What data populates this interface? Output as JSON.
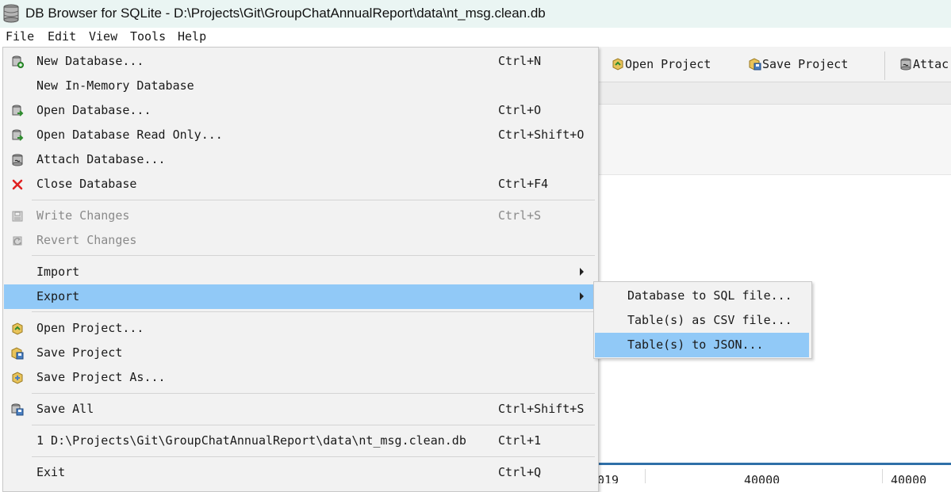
{
  "window": {
    "title": "DB Browser for SQLite - D:\\Projects\\Git\\GroupChatAnnualReport\\data\\nt_msg.clean.db",
    "icon": "database-icon"
  },
  "menubar": [
    "File",
    "Edit",
    "View",
    "Tools",
    "Help"
  ],
  "toolbar": {
    "open_project": "Open Project",
    "save_project": "Save Project",
    "attach": "Attac"
  },
  "file_menu": [
    {
      "label": "New Database...",
      "shortcut": "Ctrl+N",
      "icon": "new-database-icon"
    },
    {
      "label": "New In-Memory Database",
      "shortcut": "",
      "icon": ""
    },
    {
      "label": "Open Database...",
      "shortcut": "Ctrl+O",
      "icon": "open-database-icon"
    },
    {
      "label": "Open Database Read Only...",
      "shortcut": "Ctrl+Shift+O",
      "icon": "open-database-readonly-icon"
    },
    {
      "label": "Attach Database...",
      "shortcut": "",
      "icon": "attach-database-icon"
    },
    {
      "label": "Close Database",
      "shortcut": "Ctrl+F4",
      "icon": "close-icon"
    },
    {
      "label": "Write Changes",
      "shortcut": "Ctrl+S",
      "icon": "write-changes-icon",
      "disabled": true
    },
    {
      "label": "Revert Changes",
      "shortcut": "",
      "icon": "revert-changes-icon",
      "disabled": true
    },
    {
      "label": "Import",
      "shortcut": "",
      "icon": "",
      "submenu": true
    },
    {
      "label": "Export",
      "shortcut": "",
      "icon": "",
      "submenu": true,
      "highlighted": true
    },
    {
      "label": "Open Project...",
      "shortcut": "",
      "icon": "open-project-icon"
    },
    {
      "label": "Save Project",
      "shortcut": "",
      "icon": "save-project-icon"
    },
    {
      "label": "Save Project As...",
      "shortcut": "",
      "icon": "save-project-as-icon"
    },
    {
      "label": "Save All",
      "shortcut": "Ctrl+Shift+S",
      "icon": "save-all-icon"
    },
    {
      "label": "1 D:\\Projects\\Git\\GroupChatAnnualReport\\data\\nt_msg.clean.db",
      "shortcut": "Ctrl+1",
      "icon": ""
    },
    {
      "label": "Exit",
      "shortcut": "Ctrl+Q",
      "icon": ""
    }
  ],
  "export_submenu": [
    {
      "label": "Database to SQL file..."
    },
    {
      "label": "Table(s) as CSV file..."
    },
    {
      "label": "Table(s) to JSON...",
      "highlighted": true
    }
  ],
  "background_table": {
    "cells": [
      "019",
      "40000",
      "40000"
    ]
  },
  "colors": {
    "highlight": "#91c9f7",
    "menu_bg": "#f2f2f2",
    "titlebar_bg": "#eaf5f3",
    "disabled_text": "#8a8a8a",
    "close_red": "#e02020"
  }
}
